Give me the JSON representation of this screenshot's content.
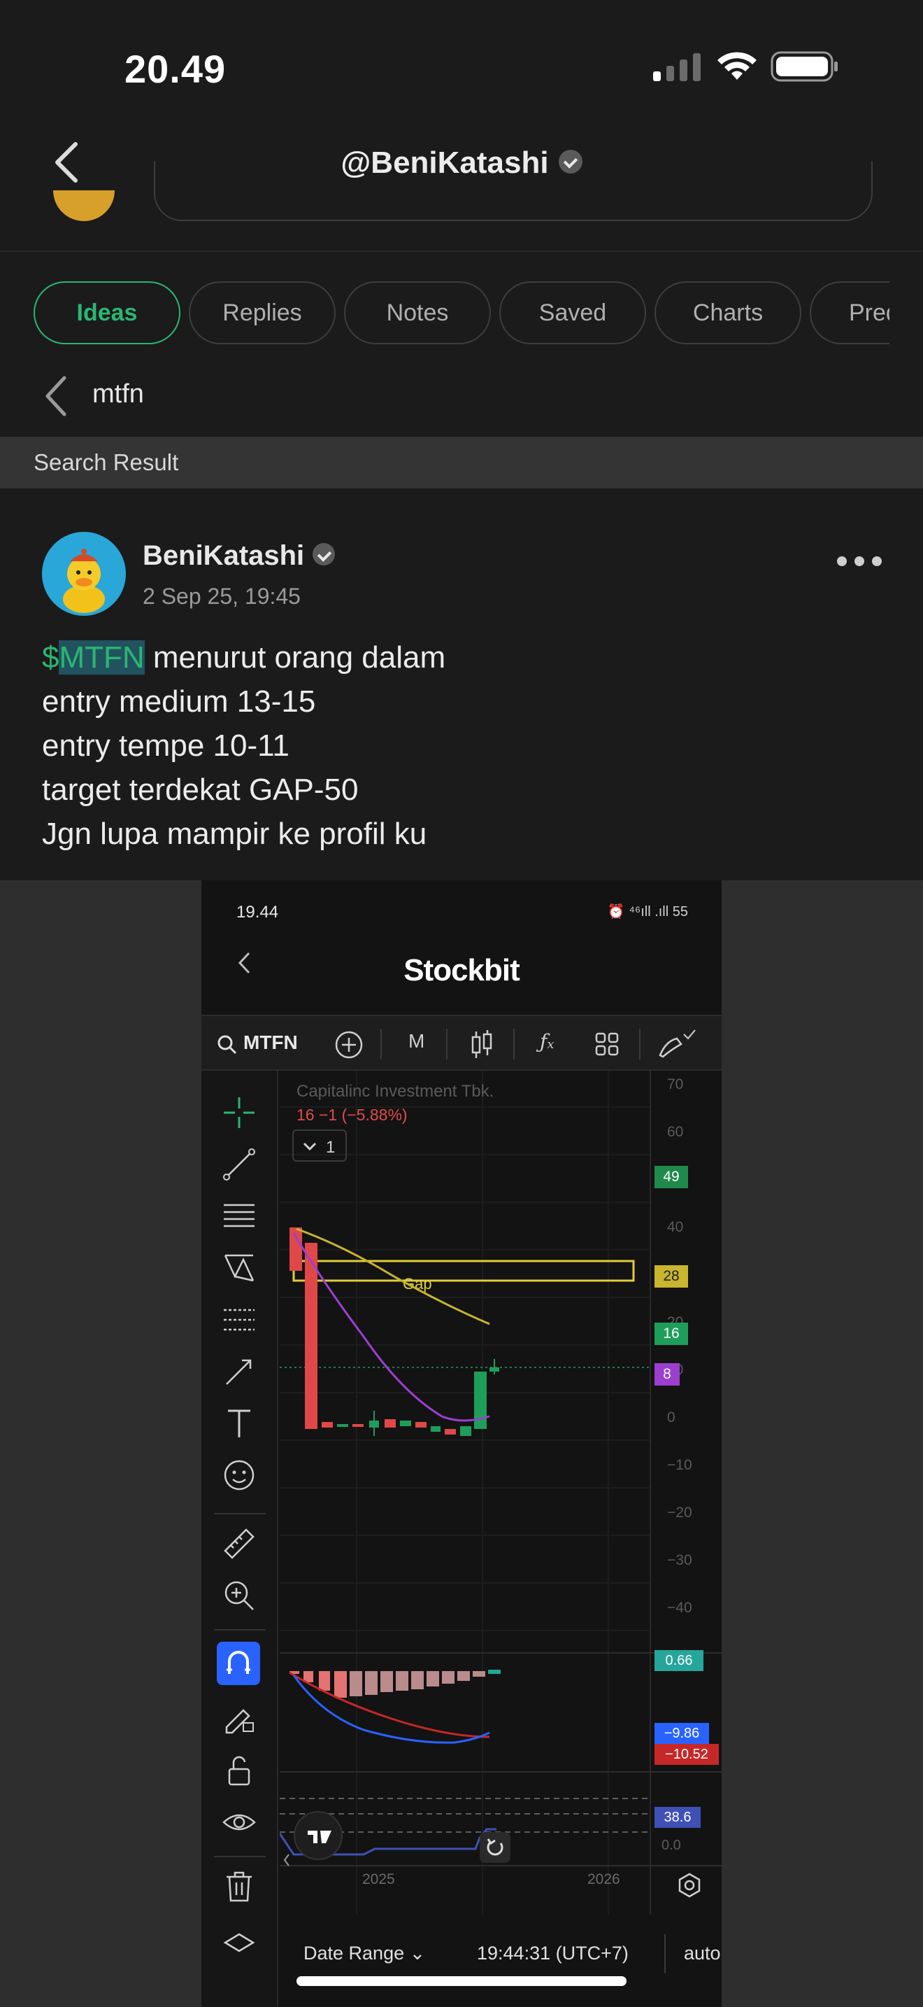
{
  "status_bar": {
    "time": "20.49"
  },
  "header": {
    "handle": "@BeniKatashi"
  },
  "tabs": [
    "Ideas",
    "Replies",
    "Notes",
    "Saved",
    "Charts",
    "Pred"
  ],
  "search": {
    "query": "mtfn",
    "result_label": "Search Result"
  },
  "post": {
    "author": "BeniKatashi",
    "date": "2 Sep 25, 19:45",
    "ticker_prefix": "$",
    "ticker": "MTFN",
    "line1_rest": " menurut orang dalam",
    "line2": "entry medium 13-15",
    "line3": "entry tempe 10-11",
    "line4": "target terdekat GAP-50",
    "line5": "Jgn lupa mampir ke profil ku"
  },
  "embedded_screenshot": {
    "time": "19.44",
    "status_right": "⏰ ⁴⁶ıll .ıll 55",
    "app_logo": "Stockbit",
    "toolbar": {
      "symbol": "MTFN",
      "interval": "M"
    },
    "chart": {
      "company": "Capitalinc Investment Tbk.",
      "price_change": "16  −1 (−5.88%)",
      "interval_value": "1",
      "gap_label": "Gap",
      "price_axis": [
        "70",
        "60",
        "50",
        "40",
        "30",
        "20",
        "10",
        "0",
        "−10",
        "−20",
        "−30",
        "−40"
      ],
      "price_tags": [
        {
          "value": "49",
          "color": "#1f8a4c"
        },
        {
          "value": "28",
          "color": "#c9b52e"
        },
        {
          "value": "16",
          "color": "#1e9e5a"
        },
        {
          "value": "8",
          "color": "#9c3fcf"
        }
      ],
      "macd_tags": [
        {
          "value": "0.66",
          "color": "#26a69a"
        },
        {
          "value": "−9.86",
          "color": "#2962ff"
        },
        {
          "value": "−10.52",
          "color": "#c62828"
        }
      ],
      "rsi_tags": [
        {
          "value": "38.6",
          "color": "#3f51b5"
        },
        {
          "value": "0.0",
          "color": "none"
        }
      ],
      "time_axis": [
        "2025",
        "2026"
      ]
    },
    "footer": {
      "date_range": "Date Range ⌄",
      "timestamp": "19:44:31 (UTC+7)",
      "scale": "auto"
    }
  }
}
